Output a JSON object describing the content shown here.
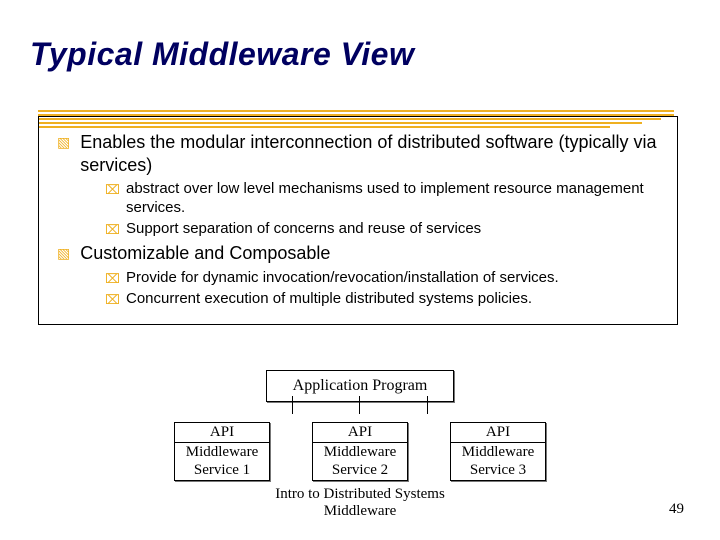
{
  "title": "Typical Middleware View",
  "bullets": {
    "b1": "Enables the modular interconnection of distributed software (typically via services)",
    "b1a": "abstract over low level mechanisms used to implement resource management services.",
    "b1b": " Support separation of concerns and reuse of  services",
    "b2": "Customizable and  Composable",
    "b2a": "Provide for dynamic invocation/revocation/installation of services.",
    "b2b": "Concurrent execution of multiple distributed systems policies."
  },
  "diagram": {
    "app": "Application Program",
    "api": "API",
    "services": [
      "Middleware Service 1",
      "Middleware Service 2",
      "Middleware Service 3"
    ]
  },
  "footer": {
    "line1": "Intro to Distributed Systems",
    "line2": "Middleware"
  },
  "page": "49"
}
